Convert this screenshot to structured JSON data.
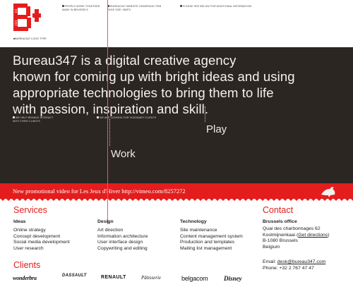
{
  "header": {
    "logo_alt": "B+",
    "logo_caption": [
      "BUREAU347 LOGO TYPE"
    ],
    "note_left": [
      "PEOPLE WORK TOGETHER",
      "MADE IN BRUSSELS"
    ],
    "note_middle": [
      "BUREAU347 WEBSITE HOMEPAGE ITEM",
      "PAGE SIZE: 960PX"
    ],
    "note_right": [
      "PLEASE SEE BELOW FOR ADDITIONAL INFORMATION"
    ]
  },
  "intro": {
    "lines": [
      "Bureau347 is a digital creative agency",
      "known for coming up with bright ideas and using",
      "appropriate technologies to bring them to life",
      "with passion, inspiration and skill."
    ],
    "note_left": [
      "WE HELP BRANDS INTERACT",
      "WITH THEIR CLIENTS"
    ],
    "note_middle": [
      "WE ARE LOOKING FOR VISIONARY CLIENTS"
    ],
    "play_label": "Play",
    "work_label": "Work"
  },
  "promo": {
    "text": "New promotional video for Les Jeux d'Hiver http://vimeo.com/8257272"
  },
  "services": {
    "title": "Services",
    "columns": [
      {
        "heading": "Ideas",
        "items": [
          "Online strategy",
          "Concept development",
          "Social media development",
          "User research"
        ]
      },
      {
        "heading": "Design",
        "items": [
          "Art direction",
          "Information architecture",
          "User interface design",
          "Copywriting and editing"
        ]
      },
      {
        "heading": "Technology",
        "items": [
          "Site maintenance",
          "Content management system",
          "Production and templates",
          "Mailing list management"
        ]
      }
    ]
  },
  "contact": {
    "title": "Contact",
    "office": "Brussels office",
    "address_1": "Quai des charbonnages 62",
    "address_2_prefix": "Koolmijnenkaai (",
    "directions_link": "Get directions",
    "address_2_suffix": ")",
    "address_3": "B-1080 Brussels",
    "address_4": "Belgium",
    "email_prefix": "Email: ",
    "email": "desk@bureau347.com",
    "phone": "Phone: +32 2 767 47 47"
  },
  "clients": {
    "title": "Clients",
    "logos": [
      "wonderbra",
      "DASSAULT",
      "RENAULT",
      "Pâtisserie",
      "belgacom",
      "Disney"
    ]
  },
  "colors": {
    "accent": "#e31d1d",
    "dark": "#2c2623",
    "guide": "#ff3fa0"
  }
}
